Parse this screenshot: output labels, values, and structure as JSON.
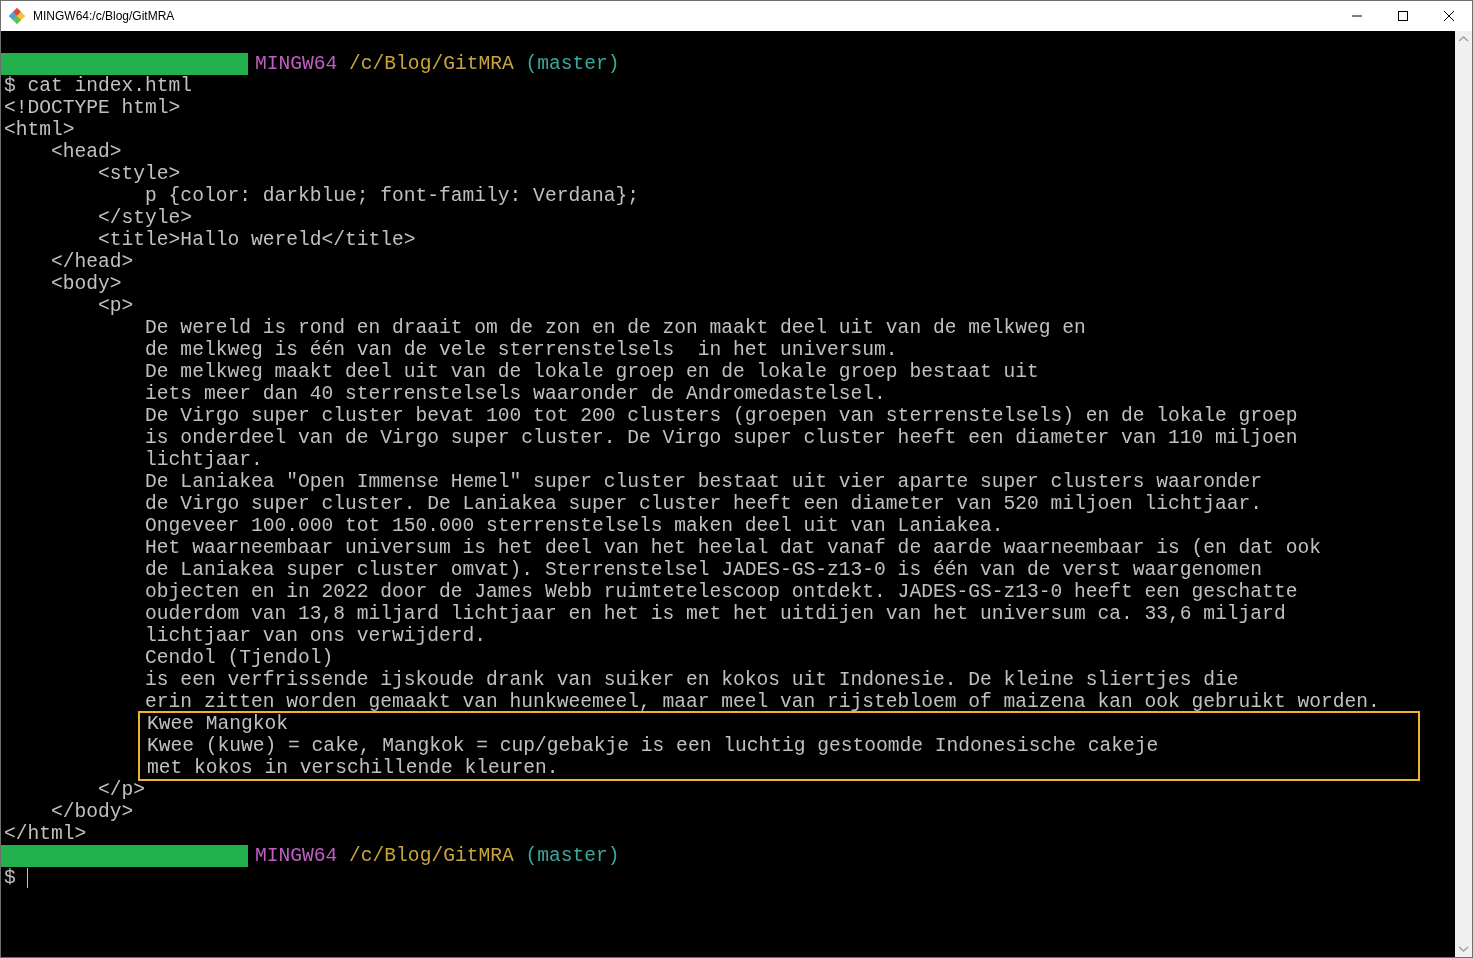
{
  "window": {
    "title": "MINGW64:/c/Blog/GitMRA"
  },
  "terminal": {
    "blocks": [
      {
        "kind": "prompt",
        "host": "MINGW64",
        "path": "/c/Blog/GitMRA",
        "branch": "(master)"
      },
      {
        "kind": "output",
        "lines": [
          "$ cat index.html",
          "<!DOCTYPE html>",
          "<html>",
          "    <head>",
          "        <style>",
          "            p {color: darkblue; font-family: Verdana};",
          "        </style>",
          "        <title>Hallo wereld</title>",
          "    </head>",
          "    <body>",
          "        <p>",
          "            De wereld is rond en draait om de zon en de zon maakt deel uit van de melkweg en",
          "            de melkweg is één van de vele sterrenstelsels  in het universum.",
          "            De melkweg maakt deel uit van de lokale groep en de lokale groep bestaat uit",
          "            iets meer dan 40 sterrenstelsels waaronder de Andromedastelsel.",
          "            De Virgo super cluster bevat 100 tot 200 clusters (groepen van sterrenstelsels) en de lokale groep",
          "            is onderdeel van de Virgo super cluster. De Virgo super cluster heeft een diameter van 110 miljoen",
          "            lichtjaar.",
          "            De Laniakea \"Open Immense Hemel\" super cluster bestaat uit vier aparte super clusters waaronder",
          "            de Virgo super cluster. De Laniakea super cluster heeft een diameter van 520 miljoen lichtjaar.",
          "            Ongeveer 100.000 tot 150.000 sterrenstelsels maken deel uit van Laniakea.",
          "            Het waarneembaar universum is het deel van het heelal dat vanaf de aarde waarneembaar is (en dat ook",
          "            de Laniakea super cluster omvat). Sterrenstelsel JADES-GS-z13-0 is één van de verst waargenomen",
          "            objecten en in 2022 door de James Webb ruimtetelescoop ontdekt. JADES-GS-z13-0 heeft een geschatte",
          "            ouderdom van 13,8 miljard lichtjaar en het is met het uitdijen van het universum ca. 33,6 miljard",
          "            lichtjaar van ons verwijderd.",
          "            Cendol (Tjendol)",
          "            is een verfrissende ijskoude drank van suiker en kokos uit Indonesie. De kleine sliertjes die",
          "            erin zitten worden gemaakt van hunkweemeel, maar meel van rijstebloem of maizena kan ook gebruikt worden."
        ]
      },
      {
        "kind": "highlight",
        "lines": [
          "Kwee Mangkok",
          "Kwee (kuwe) = cake, Mangkok = cup/gebakje is een luchtig gestoomde Indonesische cakeje",
          "met kokos in verschillende kleuren."
        ]
      },
      {
        "kind": "output",
        "lines": [
          "        </p>",
          "    </body>",
          "</html>"
        ]
      },
      {
        "kind": "prompt",
        "host": "MINGW64",
        "path": "/c/Blog/GitMRA",
        "branch": "(master)"
      },
      {
        "kind": "input",
        "text": "$"
      }
    ]
  }
}
